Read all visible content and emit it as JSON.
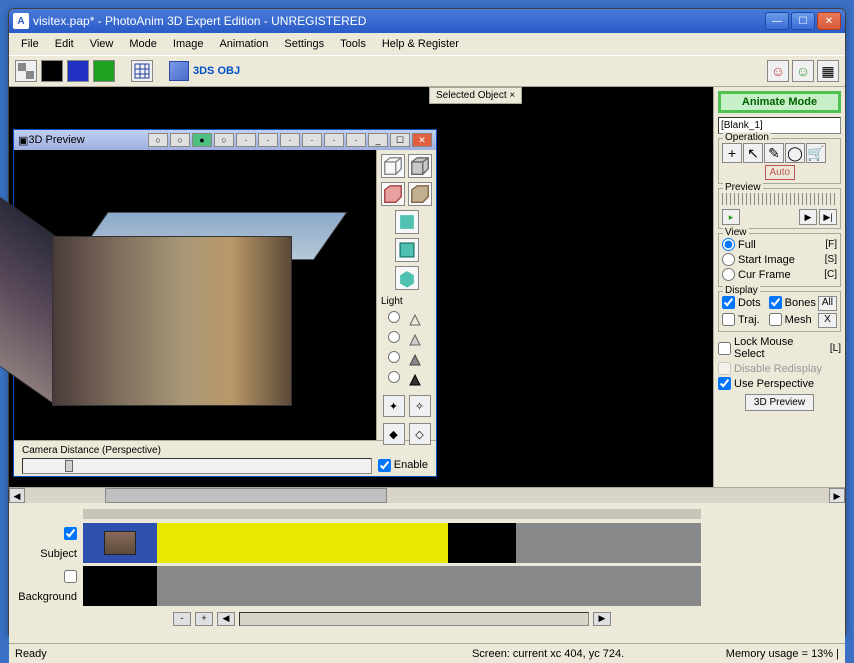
{
  "titlebar": {
    "app_icon": "A",
    "title": "visitex.pap* - PhotoAnim 3D Expert Edition - UNREGISTERED"
  },
  "menu": {
    "file": "File",
    "edit": "Edit",
    "view": "View",
    "mode": "Mode",
    "image": "Image",
    "animation": "Animation",
    "settings": "Settings",
    "tools": "Tools",
    "help": "Help & Register"
  },
  "toolbar": {
    "obj3ds": "3DS OBJ"
  },
  "tab": {
    "selected": "Selected Object  ×"
  },
  "preview_window": {
    "title": "3D Preview",
    "light": "Light",
    "camera_label": "Camera Distance (Perspective)",
    "enable": "Enable"
  },
  "sidepanel": {
    "animate": "Animate Mode",
    "name": "[Blank_1]",
    "operation": "Operation",
    "auto": "Auto",
    "preview": "Preview",
    "view": "View",
    "view_full": "Full",
    "view_full_key": "[F]",
    "view_start": "Start Image",
    "view_start_key": "[S]",
    "view_cur": "Cur Frame",
    "view_cur_key": "[C]",
    "display": "Display",
    "dots": "Dots",
    "bones": "Bones",
    "all": "All",
    "traj": "Traj.",
    "mesh": "Mesh",
    "x": "X",
    "lock": "Lock Mouse Select",
    "lock_key": "[L]",
    "disable": "Disable Redisplay",
    "perspective": "Use Perspective",
    "preview3d": "3D Preview"
  },
  "timeline": {
    "subject": "Subject",
    "background": "Background"
  },
  "status": {
    "ready": "Ready",
    "coords": "Screen: current xc 404, yc 724.",
    "memory": "Memory usage = 13% |"
  }
}
